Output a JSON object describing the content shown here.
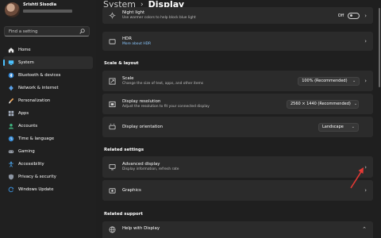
{
  "user": {
    "name": "Srishti Sisodia"
  },
  "search": {
    "placeholder": "Find a setting"
  },
  "sidebar": {
    "items": [
      {
        "label": "Home",
        "icon": "home-icon",
        "active": false
      },
      {
        "label": "System",
        "icon": "system-icon",
        "active": true
      },
      {
        "label": "Bluetooth & devices",
        "icon": "bluetooth-icon",
        "active": false
      },
      {
        "label": "Network & internet",
        "icon": "network-icon",
        "active": false
      },
      {
        "label": "Personalization",
        "icon": "brush-icon",
        "active": false
      },
      {
        "label": "Apps",
        "icon": "apps-icon",
        "active": false
      },
      {
        "label": "Accounts",
        "icon": "accounts-icon",
        "active": false
      },
      {
        "label": "Time & language",
        "icon": "time-icon",
        "active": false
      },
      {
        "label": "Gaming",
        "icon": "gaming-icon",
        "active": false
      },
      {
        "label": "Accessibility",
        "icon": "accessibility-icon",
        "active": false
      },
      {
        "label": "Privacy & security",
        "icon": "shield-icon",
        "active": false
      },
      {
        "label": "Windows Update",
        "icon": "update-icon",
        "active": false
      }
    ]
  },
  "header": {
    "crumb": "System",
    "separator": "›",
    "current": "Display"
  },
  "night_light": {
    "title": "Night light",
    "subtitle": "Use warmer colors to help block blue light",
    "state": "Off"
  },
  "hdr": {
    "title": "HDR",
    "link": "More about HDR"
  },
  "scale_layout": {
    "heading": "Scale & layout",
    "scale": {
      "title": "Scale",
      "subtitle": "Change the size of text, apps, and other items",
      "value": "100% (Recommended)"
    },
    "resolution": {
      "title": "Display resolution",
      "subtitle": "Adjust the resolution to fit your connected display",
      "value": "2560 × 1440 (Recommended)"
    },
    "orientation": {
      "title": "Display orientation",
      "value": "Landscape"
    }
  },
  "related_settings": {
    "heading": "Related settings",
    "advanced": {
      "title": "Advanced display",
      "subtitle": "Display information, refresh rate"
    },
    "graphics": {
      "title": "Graphics"
    }
  },
  "related_support": {
    "heading": "Related support",
    "help": {
      "title": "Help with Display"
    }
  },
  "colors": {
    "accent": "#4cc2ff",
    "annotation": "#e53935",
    "card": "#2b2b2b"
  }
}
